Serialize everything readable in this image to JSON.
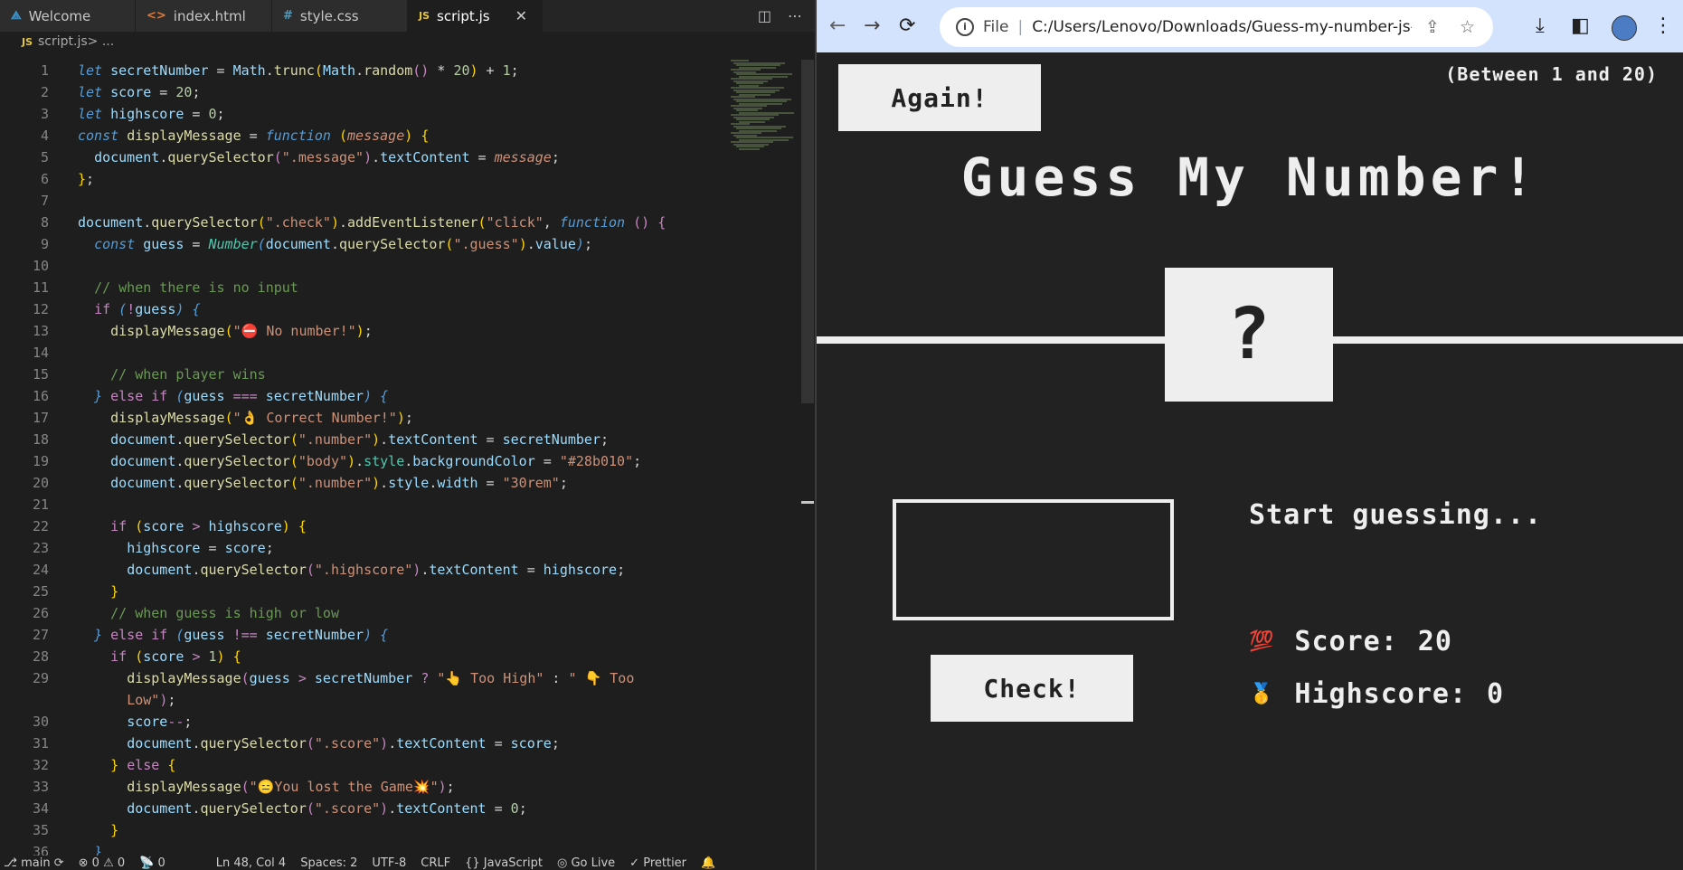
{
  "vscode": {
    "tabs": [
      {
        "label": "Welcome",
        "icon": "vscode-logo-icon"
      },
      {
        "label": "index.html",
        "icon": "html-file-icon"
      },
      {
        "label": "style.css",
        "icon": "css-file-icon"
      },
      {
        "label": "script.js",
        "icon": "js-file-icon"
      }
    ],
    "tab_icon_glyphs": {
      "welcome": "⟁",
      "html": "<>",
      "css": "#",
      "js": "JS"
    },
    "close_glyph": "✕",
    "breadcrumb": {
      "icon": "JS",
      "file": "script.js",
      "rest": " > ..."
    },
    "code_lines": [
      {
        "n": "1",
        "html": "<span class='k'>let</span> <span class='v'>secretNumber</span> = <span class='v'>Math</span>.<span class='f'>trunc</span><span class='p'>(</span><span class='v'>Math</span>.<span class='f'>random</span><span class='c'>()</span> * <span class='n'>20</span><span class='p'>)</span> + <span class='n'>1</span>;"
      },
      {
        "n": "2",
        "html": "<span class='k'>let</span> <span class='v'>score</span> = <span class='n'>20</span>;"
      },
      {
        "n": "3",
        "html": "<span class='k'>let</span> <span class='v'>highscore</span> = <span class='n'>0</span>;"
      },
      {
        "n": "4",
        "html": "<span class='k'>const</span> <span class='f'>displayMessage</span> = <span class='k'>function</span> <span class='p'>(</span><span class='s'><i>message</i></span><span class='p'>)</span> <span class='p'>{</span>"
      },
      {
        "n": "5",
        "html": "  <span class='v'>document</span>.<span class='f'>querySelector</span><span class='c'>(</span><span class='s'>\".message\"</span><span class='c'>)</span>.<span class='v'>textContent</span> = <span class='s'><i>message</i></span>;"
      },
      {
        "n": "6",
        "html": "<span class='p'>}</span>;"
      },
      {
        "n": "7",
        "html": ""
      },
      {
        "n": "8",
        "html": "<span class='v'>document</span>.<span class='f'>querySelector</span><span class='p'>(</span><span class='s'>\".check\"</span><span class='p'>)</span>.<span class='f'>addEventListener</span><span class='p'>(</span><span class='s'>\"click\"</span>, <span class='k'>function</span> <span class='c'>()</span> <span class='c'>{</span>"
      },
      {
        "n": "9",
        "html": "  <span class='k'>const</span> <span class='v'>guess</span> = <span class='t'><i>Number</i></span><span class='k'>(</span><span class='v'>document</span>.<span class='f'>querySelector</span><span class='p'>(</span><span class='s'>\".guess\"</span><span class='p'>)</span>.<span class='v'>value</span><span class='k'>)</span>;"
      },
      {
        "n": "10",
        "html": ""
      },
      {
        "n": "11",
        "html": "  <span class='cm'>// when there is no input</span>"
      },
      {
        "n": "12",
        "html": "  <span class='c'>if</span> <span class='k'>(</span><span class='c'>!</span><span class='v'>guess</span><span class='k'>)</span> <span class='k'>{</span>"
      },
      {
        "n": "13",
        "html": "    <span class='f'>displayMessage</span><span class='p'>(</span><span class='s'>\"⛔ No number!\"</span><span class='p'>)</span>;"
      },
      {
        "n": "14",
        "html": ""
      },
      {
        "n": "15",
        "html": "    <span class='cm'>// when player wins</span>"
      },
      {
        "n": "16",
        "html": "  <span class='k'>}</span> <span class='c'>else if</span> <span class='k'>(</span><span class='v'>guess</span> <span class='c'>===</span> <span class='v'>secretNumber</span><span class='k'>)</span> <span class='k'>{</span>"
      },
      {
        "n": "17",
        "html": "    <span class='f'>displayMessage</span><span class='p'>(</span><span class='s'>\"👌 Correct Number!\"</span><span class='p'>)</span>;"
      },
      {
        "n": "18",
        "html": "    <span class='v'>document</span>.<span class='f'>querySelector</span><span class='p'>(</span><span class='s'>\".number\"</span><span class='p'>)</span>.<span class='v'>textContent</span> = <span class='v'>secretNumber</span>;"
      },
      {
        "n": "19",
        "html": "    <span class='v'>document</span>.<span class='f'>querySelector</span><span class='p'>(</span><span class='s'>\"body\"</span><span class='p'>)</span>.<span class='t'>style</span>.<span class='v'>backgroundColor</span> = <span class='s'>\"#28b010\"</span>;"
      },
      {
        "n": "20",
        "html": "    <span class='v'>document</span>.<span class='f'>querySelector</span><span class='p'>(</span><span class='s'>\".number\"</span><span class='p'>)</span>.<span class='v'>style</span>.<span class='v'>width</span> = <span class='s'>\"30rem\"</span>;"
      },
      {
        "n": "21",
        "html": ""
      },
      {
        "n": "22",
        "html": "    <span class='c'>if</span> <span class='p'>(</span><span class='v'>score</span> <span class='c'>&gt;</span> <span class='v'>highscore</span><span class='p'>)</span> <span class='p'>{</span>"
      },
      {
        "n": "23",
        "html": "      <span class='v'>highscore</span> = <span class='v'>score</span>;"
      },
      {
        "n": "24",
        "html": "      <span class='v'>document</span>.<span class='f'>querySelector</span><span class='c'>(</span><span class='s'>\".highscore\"</span><span class='c'>)</span>.<span class='v'>textContent</span> = <span class='v'>highscore</span>;"
      },
      {
        "n": "25",
        "html": "    <span class='p'>}</span>"
      },
      {
        "n": "26",
        "html": "    <span class='cm'>// when guess is high or low</span>"
      },
      {
        "n": "27",
        "html": "  <span class='k'>}</span> <span class='c'>else if</span> <span class='k'>(</span><span class='v'>guess</span> <span class='c'>!==</span> <span class='v'>secretNumber</span><span class='k'>)</span> <span class='k'>{</span>"
      },
      {
        "n": "28",
        "html": "    <span class='c'>if</span> <span class='p'>(</span><span class='v'>score</span> <span class='c'>&gt;</span> <span class='n'>1</span><span class='p'>)</span> <span class='p'>{</span>"
      },
      {
        "n": "29",
        "html": "      <span class='f'>displayMessage</span><span class='c'>(</span><span class='v'>guess</span> <span class='c'>&gt;</span> <span class='v'>secretNumber</span> <span class='c'>?</span> <span class='s'>\"👆 Too High\"</span> : <span class='s'>\" 👇 Too</span>"
      },
      {
        "n": "",
        "html": "      <span class='s'>Low\"</span><span class='c'>)</span>;"
      },
      {
        "n": "30",
        "html": "      <span class='v'>score</span><span class='c'>--</span>;"
      },
      {
        "n": "31",
        "html": "      <span class='v'>document</span>.<span class='f'>querySelector</span><span class='c'>(</span><span class='s'>\".score\"</span><span class='c'>)</span>.<span class='v'>textContent</span> = <span class='v'>score</span>;"
      },
      {
        "n": "32",
        "html": "    <span class='p'>}</span> <span class='c'>else</span> <span class='p'>{</span>"
      },
      {
        "n": "33",
        "html": "      <span class='f'>displayMessage</span><span class='c'>(</span><span class='s'>\"😑You lost the Game💥\"</span><span class='c'>)</span>;"
      },
      {
        "n": "34",
        "html": "      <span class='v'>document</span>.<span class='f'>querySelector</span><span class='c'>(</span><span class='s'>\".score\"</span><span class='c'>)</span>.<span class='v'>textContent</span> = <span class='n'>0</span>;"
      },
      {
        "n": "35",
        "html": "    <span class='p'>}</span>"
      },
      {
        "n": "36",
        "html": "  <span class='k'>}</span>"
      }
    ],
    "status": {
      "branch": "main",
      "problems": "⊗ 0 ⚠ 0",
      "ports": "📡 0",
      "position": "Ln 48, Col 4",
      "spaces": "Spaces: 2",
      "encoding": "UTF-8",
      "eol": "CRLF",
      "language": "{} JavaScript",
      "golive": "Go Live",
      "prettier": "Prettier"
    }
  },
  "browser": {
    "url_scheme": "File",
    "url": "C:/Users/Lenovo/Downloads/Guess-my-number-js-main/G...",
    "icons": {
      "back": "←",
      "forward": "→",
      "reload": "⟳",
      "share": "⇪",
      "star": "☆",
      "download": "⤓",
      "sidepanel": "◧",
      "menu": "⋮",
      "info": "i"
    }
  },
  "game": {
    "again_label": "Again!",
    "between_text": "(Between 1 and 20)",
    "title": "Guess My Number!",
    "number": "?",
    "guess_value": "",
    "message": "Start guessing...",
    "score_emoji": "💯",
    "score_label": "Score:",
    "score_value": "20",
    "highscore_emoji": "🥇",
    "highscore_label": "Highscore:",
    "highscore_value": "0",
    "check_label": "Check!"
  }
}
